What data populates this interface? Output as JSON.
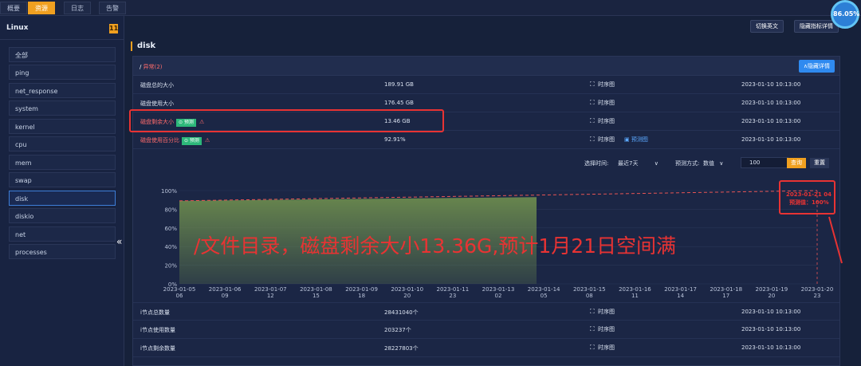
{
  "top_tabs": [
    {
      "label": "概要",
      "active": false
    },
    {
      "label": "资源",
      "active": true
    },
    {
      "label": "日志",
      "active": false
    },
    {
      "label": "告警",
      "active": false
    }
  ],
  "gauge": {
    "value": "86.05%"
  },
  "sidebar": {
    "title": "Linux",
    "badge": "11",
    "items": [
      {
        "label": "全部"
      },
      {
        "label": "ping"
      },
      {
        "label": "net_response"
      },
      {
        "label": "system"
      },
      {
        "label": "kernel"
      },
      {
        "label": "cpu"
      },
      {
        "label": "mem"
      },
      {
        "label": "swap"
      },
      {
        "label": "disk",
        "active": true
      },
      {
        "label": "diskio"
      },
      {
        "label": "net"
      },
      {
        "label": "processes"
      }
    ],
    "collapse_glyph": "«"
  },
  "main": {
    "title": "disk",
    "switch_lang": "切换英文",
    "hide_metrics": "隐藏指标详情"
  },
  "panel": {
    "path_label": "/",
    "status_label": "异常(2)",
    "hide_detail": "∧隐藏详情",
    "rows": [
      {
        "name": "磁盘总的大小",
        "value": "189.91 GB",
        "link": "时序图",
        "time": "2023-01-10 10:13:00",
        "error": false
      },
      {
        "name": "磁盘使用大小",
        "value": "176.45 GB",
        "link": "时序图",
        "time": "2023-01-10 10:13:00",
        "error": false
      },
      {
        "name": "磁盘剩余大小",
        "tag": "⊙ 预测",
        "value": "13.46 GB",
        "link": "时序图",
        "time": "2023-01-10 10:13:00",
        "error": true
      },
      {
        "name": "磁盘使用百分比",
        "tag": "⊙ 预测",
        "value": "92.91%",
        "link": "时序图",
        "link2": "预测图",
        "time": "2023-01-10 10:13:00",
        "error": true
      }
    ],
    "controls": {
      "time_label": "选择时间:",
      "time_value": "最近7天",
      "mode_label": "预测方式:",
      "mode_value": "数值",
      "input_value": "100",
      "query": "查询",
      "reset": "重置"
    },
    "bottom_rows": [
      {
        "name": "i节点总数量",
        "value": "28431040个",
        "link": "时序图",
        "time": "2023-01-10 10:13:00"
      },
      {
        "name": "i节点使用数量",
        "value": "203237个",
        "link": "时序图",
        "time": "2023-01-10 10:13:00"
      },
      {
        "name": "i节点剩余数量",
        "value": "28227803个",
        "link": "时序图",
        "time": "2023-01-10 10:13:00"
      }
    ]
  },
  "annotation": {
    "text": "/文件目录，磁盘剩余大小13.36G,预计1月21日空间满",
    "pred_line1": "2023-01-21 04",
    "pred_line2": "预测值：100%",
    "color": "#e83333"
  },
  "chart_data": {
    "type": "area",
    "ylim": [
      0,
      100
    ],
    "yticks": [
      "0%",
      "20%",
      "40%",
      "60%",
      "80%",
      "100%"
    ],
    "xticks": [
      [
        "2023-01-05",
        "06"
      ],
      [
        "2023-01-06",
        "09"
      ],
      [
        "2023-01-07",
        "12"
      ],
      [
        "2023-01-08",
        "15"
      ],
      [
        "2023-01-09",
        "18"
      ],
      [
        "2023-01-10",
        "20"
      ],
      [
        "2023-01-11",
        "23"
      ],
      [
        "2023-01-13",
        "02"
      ],
      [
        "2023-01-14",
        "05"
      ],
      [
        "2023-01-15",
        "08"
      ],
      [
        "2023-01-16",
        "11"
      ],
      [
        "2023-01-17",
        "14"
      ],
      [
        "2023-01-18",
        "17"
      ],
      [
        "2023-01-19",
        "20"
      ],
      [
        "2023-01-20",
        "23"
      ]
    ],
    "actual": {
      "x_start": 0,
      "x_end": 0.56,
      "y_start": 89,
      "y_end": 93
    },
    "forecast": {
      "x_start": 0,
      "x_end": 1.0,
      "y_start": 89,
      "y_end": 100
    },
    "fill_color": "#6b8a4e",
    "forecast_color": "#e85555"
  }
}
